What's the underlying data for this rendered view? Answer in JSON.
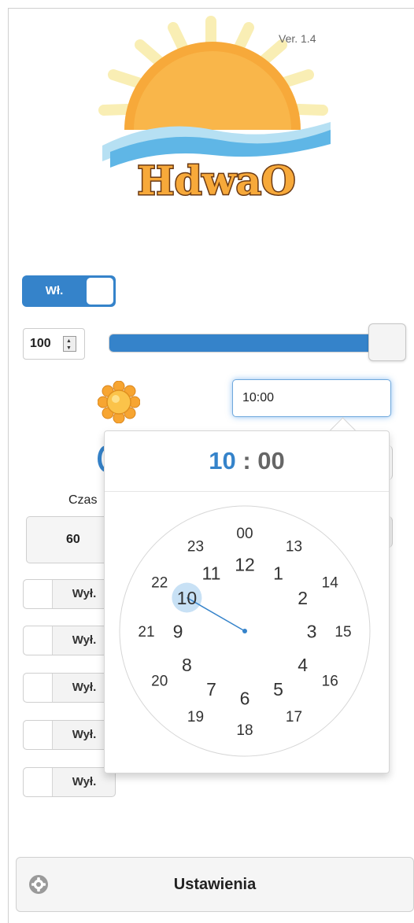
{
  "app": {
    "version": "Ver. 1.4",
    "logo_text": "HdwaO"
  },
  "controls": {
    "power_toggle_label": "Wł.",
    "brightness_value": "100",
    "brightness_fraction": 0.97,
    "time_value": "10:00"
  },
  "timepicker": {
    "hour": "10",
    "separator": ":",
    "minute": "00",
    "selected_hour": 10,
    "inner_hours": [
      "12",
      "1",
      "2",
      "3",
      "4",
      "5",
      "6",
      "7",
      "8",
      "9",
      "10",
      "11"
    ],
    "outer_hours": [
      "00",
      "13",
      "14",
      "15",
      "16",
      "17",
      "18",
      "19",
      "20",
      "21",
      "22",
      "23"
    ]
  },
  "timer": {
    "label": "Czas",
    "value": "60"
  },
  "switches": [
    {
      "label": "Wył."
    },
    {
      "label": "Wył."
    },
    {
      "label": "Wył."
    },
    {
      "label": "Wył."
    },
    {
      "label": "Wył."
    }
  ],
  "footer": {
    "settings_label": "Ustawienia"
  },
  "colors": {
    "accent": "#3583ca",
    "sun": "#f7a93a",
    "wave": "#5fb6e6"
  },
  "icons": {
    "sun": "sun-icon",
    "gear": "gear-icon"
  }
}
